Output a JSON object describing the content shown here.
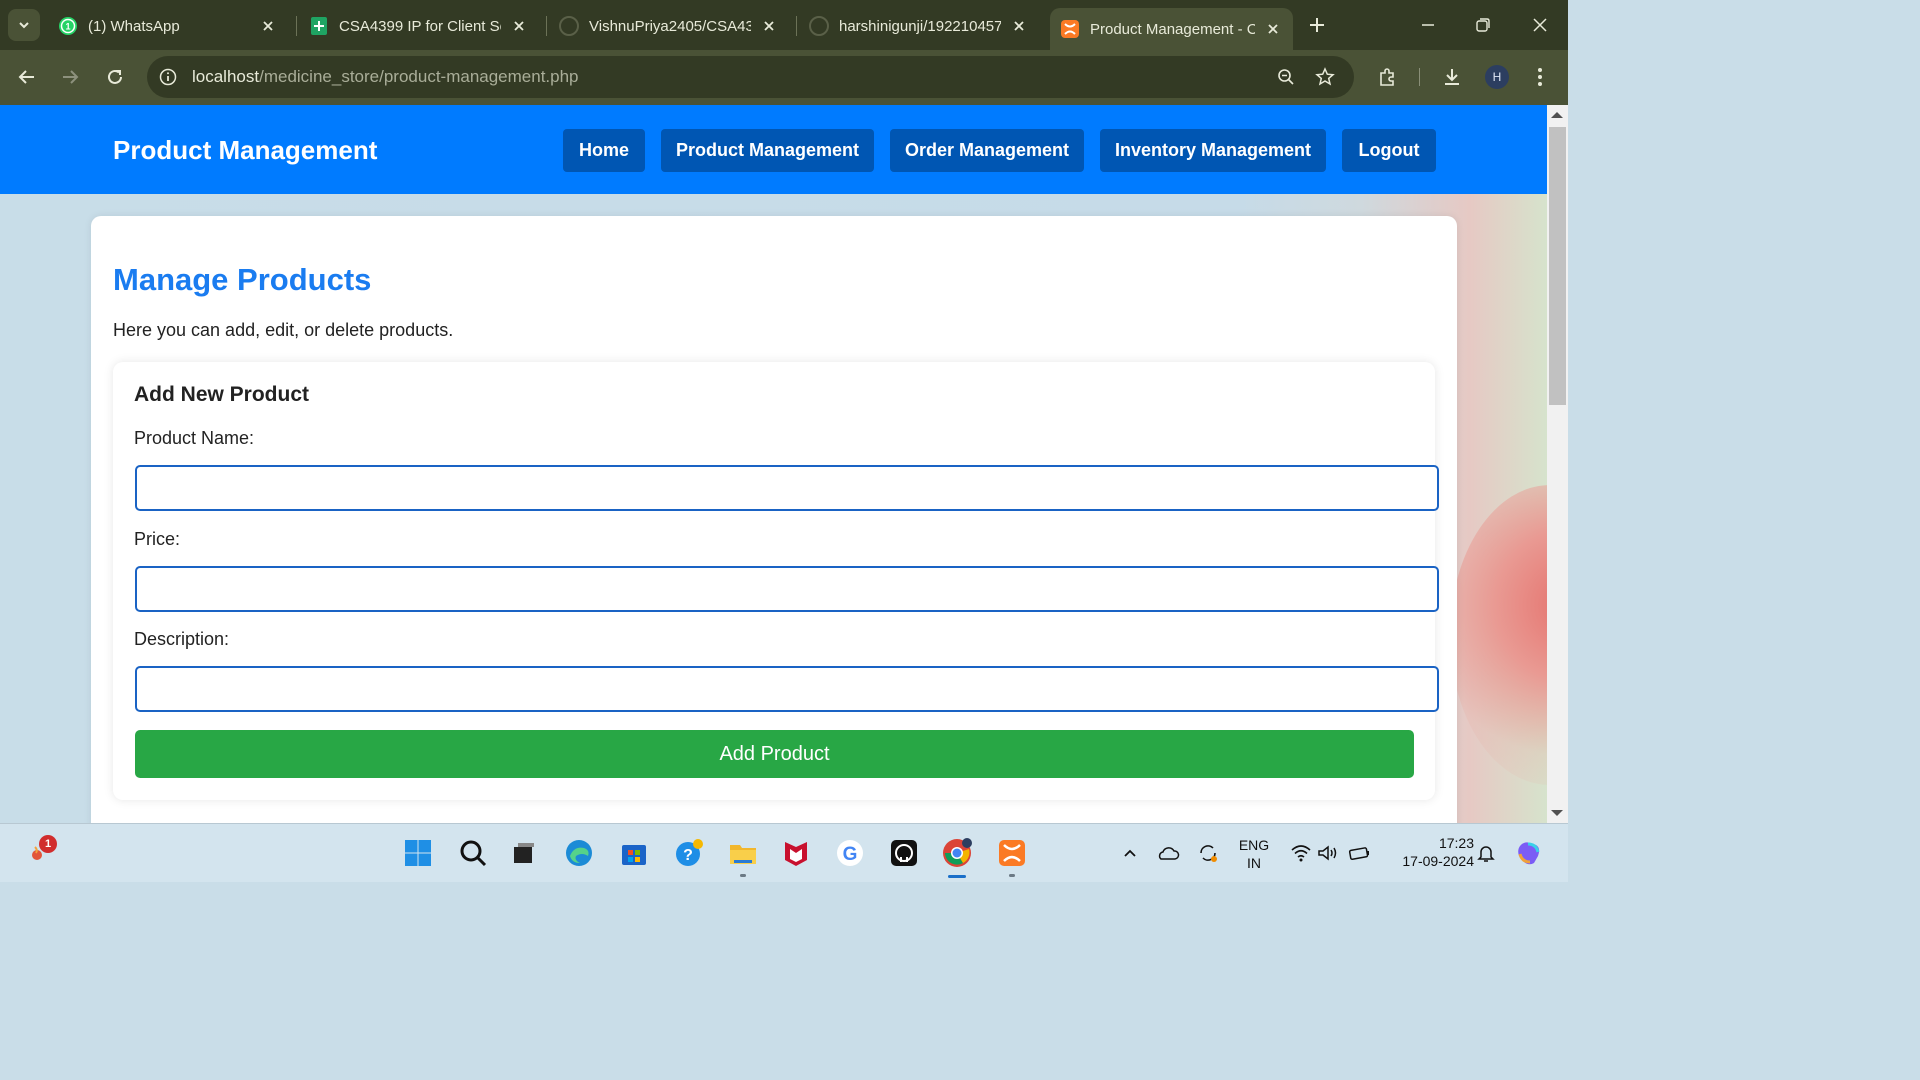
{
  "browser": {
    "tabs": [
      {
        "title": "(1) WhatsApp",
        "icon": "whatsapp-icon"
      },
      {
        "title": "CSA4399 IP for Client Ser",
        "icon": "sheets-icon"
      },
      {
        "title": "VishnuPriya2405/CSA439",
        "icon": "github-icon"
      },
      {
        "title": "harshinigunji/192210457",
        "icon": "github-icon"
      },
      {
        "title": "Product Management - C",
        "icon": "xampp-icon",
        "active": true
      }
    ],
    "url_host": "localhost",
    "url_path": "/medicine_store/product-management.php",
    "profile_initial": "H"
  },
  "site": {
    "title": "Product Management",
    "nav": [
      "Home",
      "Product Management",
      "Order Management",
      "Inventory Management",
      "Logout"
    ]
  },
  "main": {
    "heading": "Manage Products",
    "description": "Here you can add, edit, or delete products.",
    "form": {
      "title": "Add New Product",
      "name_label": "Product Name:",
      "price_label": "Price:",
      "description_label": "Description:",
      "submit_label": "Add Product"
    }
  },
  "taskbar": {
    "notification_count": "1",
    "language_1": "ENG",
    "language_2": "IN",
    "time": "17:23",
    "date": "17-09-2024"
  },
  "colors": {
    "header_blue": "#007bff",
    "nav_button": "#0056b3",
    "heading_blue": "#1a7cf0",
    "submit_green": "#28a745"
  }
}
